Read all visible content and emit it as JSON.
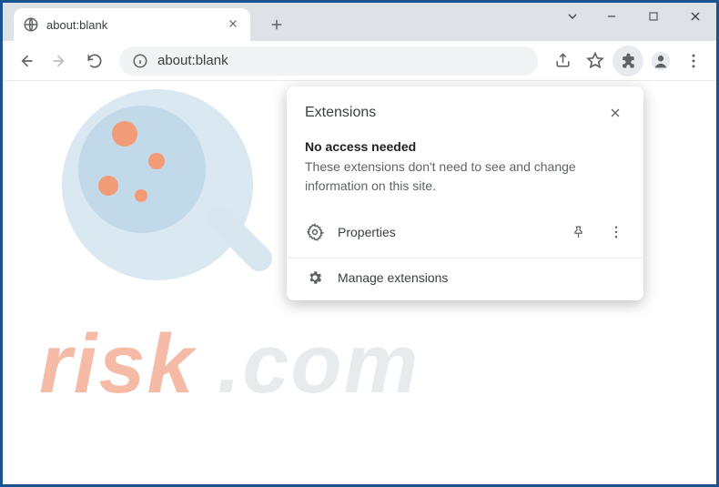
{
  "tab": {
    "title": "about:blank"
  },
  "url": "about:blank",
  "popup": {
    "title": "Extensions",
    "section_title": "No access needed",
    "section_desc": "These extensions don't need to see and change information on this site.",
    "item_label": "Properties",
    "manage_label": "Manage extensions"
  },
  "watermark": {
    "risk": "risk",
    "com": ".com"
  }
}
